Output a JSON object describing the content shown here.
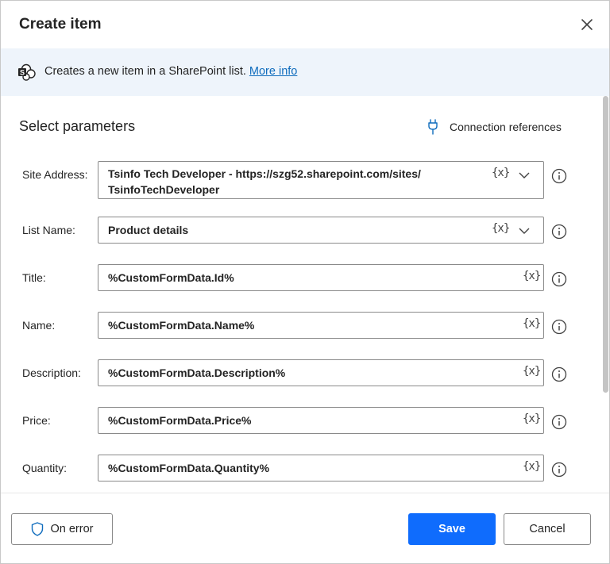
{
  "dialog": {
    "title": "Create item",
    "info_text": "Creates a new item in a SharePoint list.",
    "info_link": "More info"
  },
  "parameters": {
    "section_title": "Select parameters",
    "connection_references": "Connection references",
    "variable_label": "{x}",
    "fields": [
      {
        "label": "Site Address:",
        "value_line1": "Tsinfo Tech Developer - https://szg52.sharepoint.com/sites/",
        "value_line2": "TsinfoTechDeveloper",
        "type": "dropdown"
      },
      {
        "label": "List Name:",
        "value": "Product details",
        "type": "dropdown"
      },
      {
        "label": "Title:",
        "value": "%CustomFormData.Id%",
        "type": "text"
      },
      {
        "label": "Name:",
        "value": "%CustomFormData.Name%",
        "type": "text"
      },
      {
        "label": "Description:",
        "value": "%CustomFormData.Description%",
        "type": "text"
      },
      {
        "label": "Price:",
        "value": "%CustomFormData.Price%",
        "type": "text"
      },
      {
        "label": "Quantity:",
        "value": "%CustomFormData.Quantity%",
        "type": "text"
      }
    ]
  },
  "footer": {
    "on_error": "On error",
    "save": "Save",
    "cancel": "Cancel"
  },
  "colors": {
    "accent": "#0f6cfd",
    "link": "#0f6cbd",
    "banner_bg": "#eef4fb"
  }
}
